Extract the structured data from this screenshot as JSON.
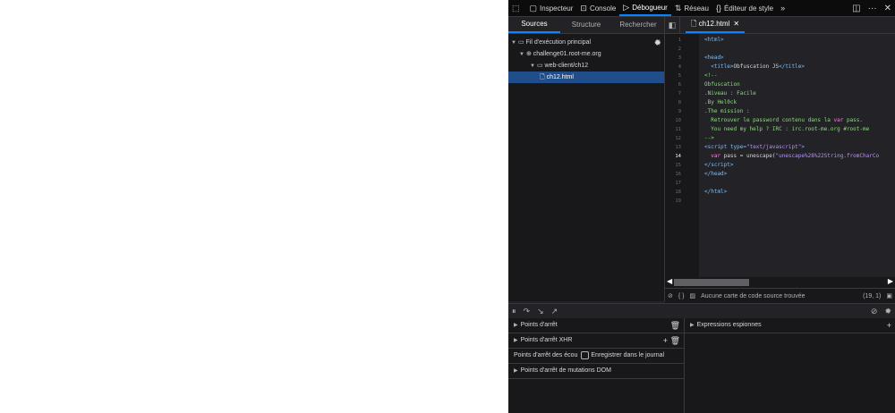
{
  "toolbar": {
    "tabs": [
      {
        "label": "Inspecteur",
        "icon": "inspector-icon"
      },
      {
        "label": "Console",
        "icon": "console-icon"
      },
      {
        "label": "Débogueur",
        "icon": "debugger-icon",
        "active": true
      },
      {
        "label": "Réseau",
        "icon": "network-icon"
      },
      {
        "label": "Éditeur de style",
        "icon": "style-editor-icon"
      }
    ]
  },
  "sources": {
    "tabs": [
      "Sources",
      "Structure",
      "Rechercher"
    ],
    "tree": {
      "thread": "Fil d'exécution principal",
      "domain": "challenge01.root-me.org",
      "folder": "web-client/ch12",
      "file": "ch12.html"
    }
  },
  "editor": {
    "tab_label": "ch12.html",
    "current_line": 14
  },
  "footer": {
    "source_map_text": "Aucune carte de code source trouvée",
    "cursor_position": "(19, 1)"
  },
  "panes": {
    "breakpoints": "Points d'arrêt",
    "xhr_breakpoints": "Points d'arrêt XHR",
    "event_breakpoints": "Points d'arrêt des écou",
    "log_label": "Enregistrer dans le journal",
    "dom_breakpoints": "Points d'arrêt de mutations DOM",
    "watch_expressions": "Expressions espionnes"
  },
  "colors": {
    "accent": "#0a84ff",
    "selection": "#204e8a",
    "tag": "#75bfff",
    "comment": "#86de74",
    "string": "#b98eff"
  }
}
